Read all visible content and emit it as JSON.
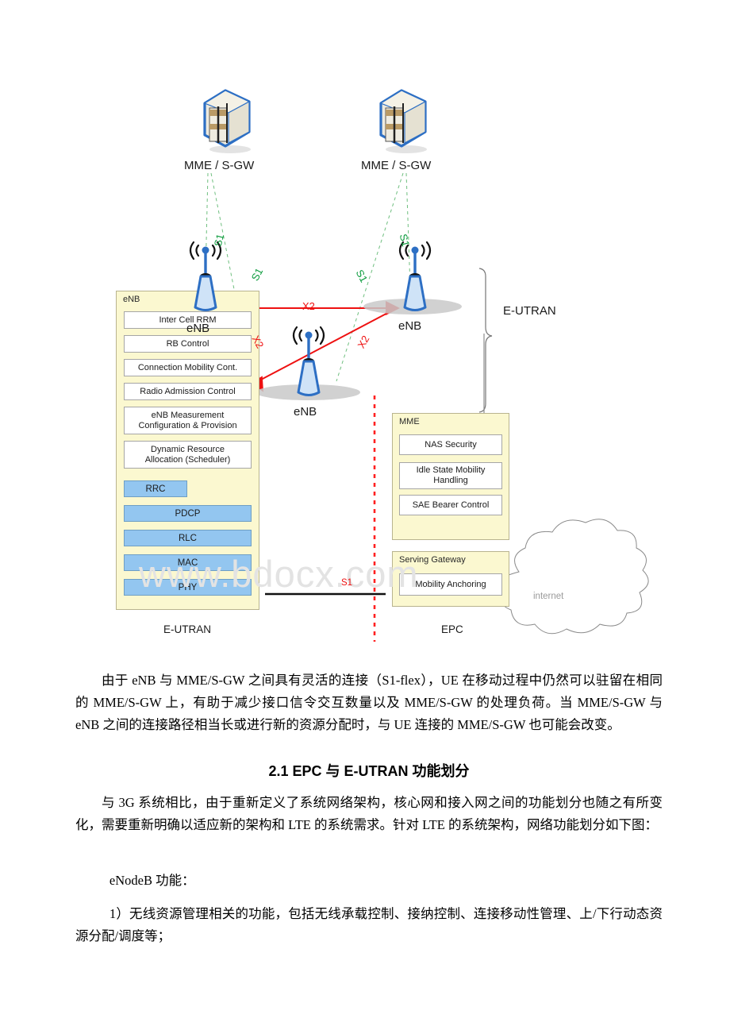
{
  "figure": {
    "watermark": "www.bdocx.com",
    "core_nodes": [
      {
        "label": "MME / S-GW",
        "icon": "server-icon"
      },
      {
        "label": "MME / S-GW",
        "icon": "server-icon"
      }
    ],
    "enb_nodes": [
      {
        "label": "eNB",
        "icon": "base-station-icon"
      },
      {
        "label": "eNB",
        "icon": "base-station-icon"
      },
      {
        "label": "eNB",
        "icon": "base-station-icon"
      }
    ],
    "interface_labels": {
      "s1": "S1",
      "x2": "X2",
      "s1_bottom": "S1"
    },
    "s1_links": [
      "S1",
      "S1",
      "S1",
      "S1"
    ],
    "x2_links": [
      "X2",
      "X2",
      "X2"
    ],
    "brace_label": "E-UTRAN",
    "enb_panel": {
      "title": "eNB",
      "functions": [
        "Inter Cell RRM",
        "RB Control",
        "Connection Mobility Cont.",
        "Radio Admission Control",
        "eNB Measurement\nConfiguration & Provision",
        "Dynamic Resource\nAllocation (Scheduler)"
      ],
      "protocols": [
        "RRC",
        "PDCP",
        "RLC",
        "MAC",
        "PHY"
      ]
    },
    "mme_panel": {
      "title": "MME",
      "functions": [
        "NAS Security",
        "Idle State Mobility\nHandling",
        "SAE Bearer Control"
      ]
    },
    "sgw_panel": {
      "title": "Serving Gateway",
      "functions": [
        "Mobility Anchoring"
      ]
    },
    "cloud_label": "internet",
    "footer_left": "E-UTRAN",
    "footer_right": "EPC",
    "colors": {
      "panel_fill": "#fbf8d0",
      "panel_border": "#b9b48f",
      "protocol_fill": "#93c6f0",
      "s1_green": "#0a9b3c",
      "x2_red": "#ee1111",
      "divider_red": "#ff2020",
      "node_blue": "#2d6fc4"
    }
  },
  "text": {
    "para1": "由于 eNB 与 MME/S-GW 之间具有灵活的连接（S1-flex），UE 在移动过程中仍然可以驻留在相同的 MME/S-GW 上，有助于减少接口信令交互数量以及 MME/S-GW 的处理负荷。当 MME/S-GW 与 eNB 之间的连接路径相当长或进行新的资源分配时，与 UE 连接的 MME/S-GW 也可能会改变。",
    "heading1": "2.1 EPC 与 E-UTRAN 功能划分",
    "para2": "与 3G 系统相比，由于重新定义了系统网络架构，核心网和接入网之间的功能划分也随之有所变化，需要重新明确以适应新的架构和 LTE 的系统需求。针对 LTE 的系统架构，网络功能划分如下图：",
    "para3": "eNodeB 功能：",
    "para4": "1）无线资源管理相关的功能，包括无线承载控制、接纳控制、连接移动性管理、上/下行动态资源分配/调度等；"
  }
}
